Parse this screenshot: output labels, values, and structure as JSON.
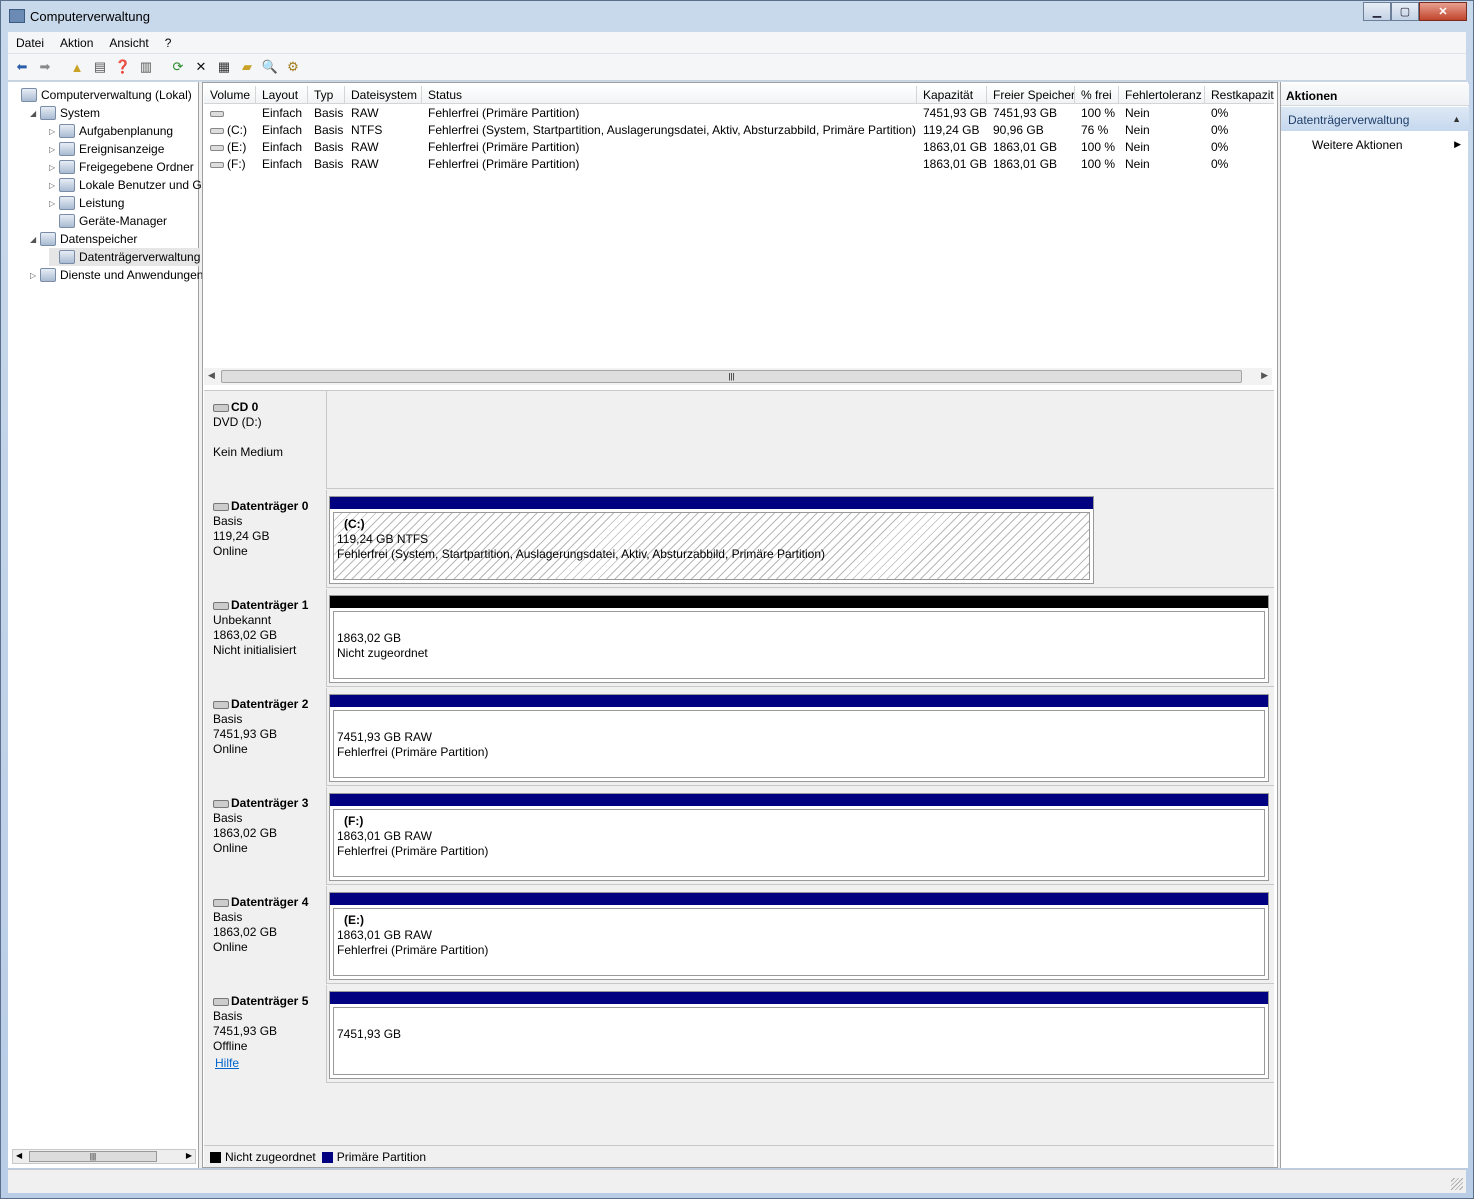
{
  "window": {
    "title": "Computerverwaltung"
  },
  "menu": [
    "Datei",
    "Aktion",
    "Ansicht",
    "?"
  ],
  "tree": [
    {
      "label": "Computerverwaltung (Lokal)",
      "level": 0,
      "expander": "",
      "name": "tree-root"
    },
    {
      "label": "System",
      "level": 1,
      "expander": "◢",
      "name": "tree-system"
    },
    {
      "label": "Aufgabenplanung",
      "level": 2,
      "expander": "▷",
      "name": "tree-aufgabenplanung"
    },
    {
      "label": "Ereignisanzeige",
      "level": 2,
      "expander": "▷",
      "name": "tree-ereignisanzeige"
    },
    {
      "label": "Freigegebene Ordner",
      "level": 2,
      "expander": "▷",
      "name": "tree-freigegebene-ordner"
    },
    {
      "label": "Lokale Benutzer und Gr",
      "level": 2,
      "expander": "▷",
      "name": "tree-lokale-benutzer"
    },
    {
      "label": "Leistung",
      "level": 2,
      "expander": "▷",
      "name": "tree-leistung"
    },
    {
      "label": "Geräte-Manager",
      "level": 2,
      "expander": "",
      "name": "tree-geraete-manager"
    },
    {
      "label": "Datenspeicher",
      "level": 1,
      "expander": "◢",
      "name": "tree-datenspeicher"
    },
    {
      "label": "Datenträgerverwaltung",
      "level": 2,
      "expander": "",
      "name": "tree-datentraegerverwaltung",
      "selected": true
    },
    {
      "label": "Dienste und Anwendungen",
      "level": 1,
      "expander": "▷",
      "name": "tree-dienste"
    }
  ],
  "volumes": {
    "headers": [
      "Volume",
      "Layout",
      "Typ",
      "Dateisystem",
      "Status",
      "Kapazität",
      "Freier Speicher",
      "% frei",
      "Fehlertoleranz",
      "Restkapazität"
    ],
    "rows": [
      [
        "",
        "Einfach",
        "Basis",
        "RAW",
        "Fehlerfrei (Primäre Partition)",
        "7451,93 GB",
        "7451,93 GB",
        "100 %",
        "Nein",
        "0%"
      ],
      [
        "(C:)",
        "Einfach",
        "Basis",
        "NTFS",
        "Fehlerfrei (System, Startpartition, Auslagerungsdatei, Aktiv, Absturzabbild, Primäre Partition)",
        "119,24 GB",
        "90,96 GB",
        "76 %",
        "Nein",
        "0%"
      ],
      [
        "(E:)",
        "Einfach",
        "Basis",
        "RAW",
        "Fehlerfrei (Primäre Partition)",
        "1863,01 GB",
        "1863,01 GB",
        "100 %",
        "Nein",
        "0%"
      ],
      [
        "(F:)",
        "Einfach",
        "Basis",
        "RAW",
        "Fehlerfrei (Primäre Partition)",
        "1863,01 GB",
        "1863,01 GB",
        "100 %",
        "Nein",
        "0%"
      ]
    ]
  },
  "disks": [
    {
      "name": "CD 0",
      "l1": "DVD (D:)",
      "l2": "",
      "l3": "Kein Medium"
    },
    {
      "name": "Datenträger 0",
      "l1": "Basis",
      "l2": "119,24 GB",
      "l3": "Online",
      "part": {
        "name": "(C:)",
        "line1": "119,24 GB NTFS",
        "line2": "Fehlerfrei (System, Startpartition, Auslagerungsdatei, Aktiv, Absturzabbild, Primäre Partition)"
      }
    },
    {
      "name": "Datenträger 1",
      "l1": "Unbekannt",
      "l2": "1863,02 GB",
      "l3": "Nicht initialisiert",
      "part": {
        "name": "",
        "line1": "1863,02 GB",
        "line2": "Nicht zugeordnet"
      }
    },
    {
      "name": "Datenträger 2",
      "l1": "Basis",
      "l2": "7451,93 GB",
      "l3": "Online",
      "part": {
        "name": "",
        "line1": "7451,93 GB RAW",
        "line2": "Fehlerfrei (Primäre Partition)"
      }
    },
    {
      "name": "Datenträger 3",
      "l1": "Basis",
      "l2": "1863,02 GB",
      "l3": "Online",
      "part": {
        "name": "(F:)",
        "line1": "1863,01 GB RAW",
        "line2": "Fehlerfrei (Primäre Partition)"
      }
    },
    {
      "name": "Datenträger 4",
      "l1": "Basis",
      "l2": "1863,02 GB",
      "l3": "Online",
      "part": {
        "name": "(E:)",
        "line1": "1863,01 GB RAW",
        "line2": "Fehlerfrei (Primäre Partition)"
      }
    },
    {
      "name": "Datenträger 5",
      "l1": "Basis",
      "l2": "7451,93 GB",
      "l3": "Offline",
      "help": "Hilfe",
      "part": {
        "name": "",
        "line1": "7451,93 GB",
        "line2": ""
      }
    }
  ],
  "legend": {
    "unallocated": "Nicht zugeordnet",
    "primary": "Primäre Partition"
  },
  "colors": {
    "primary": "#000080",
    "unallocated": "#000000"
  },
  "actions": {
    "header": "Aktionen",
    "section": "Datenträgerverwaltung",
    "more": "Weitere Aktionen"
  }
}
